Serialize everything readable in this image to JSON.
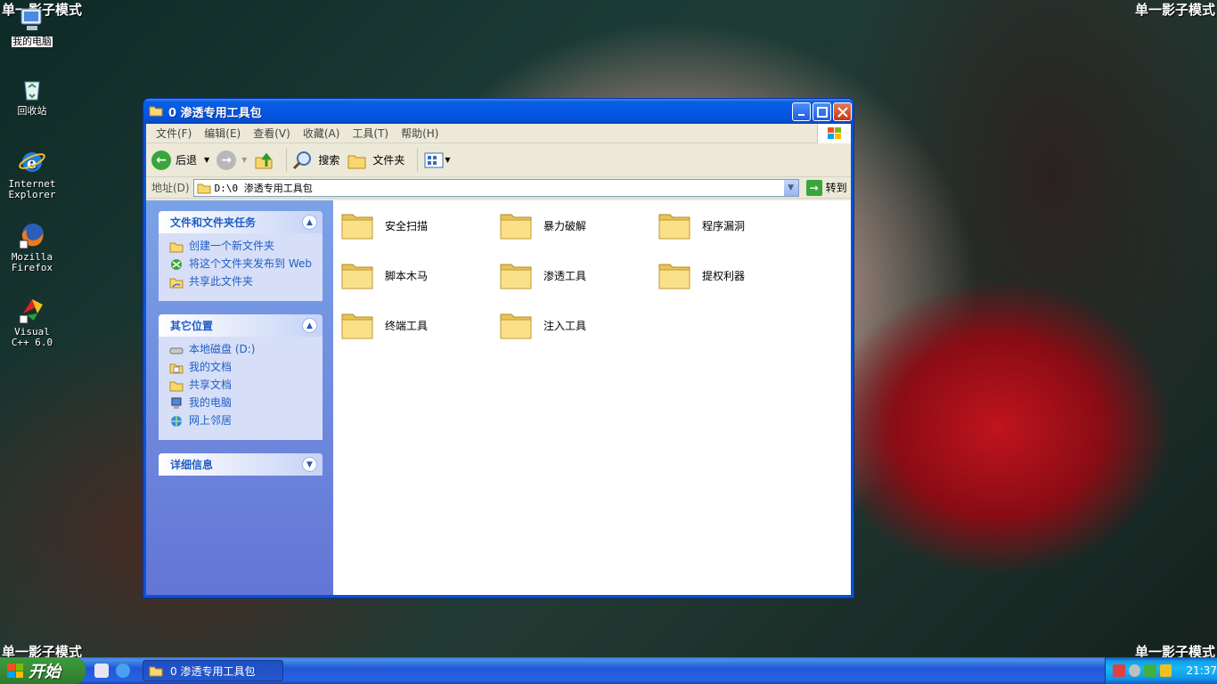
{
  "overlay": {
    "label": "单一影子模式"
  },
  "desktop": {
    "icons": [
      {
        "label": "我的电脑",
        "icon": "my-computer-icon"
      },
      {
        "label": "回收站",
        "icon": "recycle-bin-icon"
      },
      {
        "label": "Internet Explorer",
        "icon": "internet-explorer-icon"
      },
      {
        "label": "Mozilla Firefox",
        "icon": "firefox-icon"
      },
      {
        "label": "Visual C++ 6.0",
        "icon": "visual-cpp-icon"
      }
    ]
  },
  "window": {
    "title": "0 渗透专用工具包",
    "menu": [
      "文件(F)",
      "编辑(E)",
      "查看(V)",
      "收藏(A)",
      "工具(T)",
      "帮助(H)"
    ],
    "toolbar": {
      "back": "后退",
      "search": "搜索",
      "folders": "文件夹"
    },
    "address": {
      "label": "地址(D)",
      "value": "D:\\0 渗透专用工具包",
      "go": "转到"
    },
    "tasks": {
      "file_tasks": {
        "title": "文件和文件夹任务",
        "links": [
          "创建一个新文件夹",
          "将这个文件夹发布到 Web",
          "共享此文件夹"
        ]
      },
      "other_places": {
        "title": "其它位置",
        "links": [
          "本地磁盘 (D:)",
          "我的文档",
          "共享文档",
          "我的电脑",
          "网上邻居"
        ]
      },
      "details": {
        "title": "详细信息"
      }
    },
    "folders": [
      "安全扫描",
      "暴力破解",
      "程序漏洞",
      "脚本木马",
      "渗透工具",
      "提权利器",
      "终端工具",
      "注入工具"
    ]
  },
  "taskbar": {
    "start": "开始",
    "task_title": "0 渗透专用工具包",
    "clock": "21:37"
  },
  "colors": {
    "taskbar": "#2157d7",
    "start": "#388e38",
    "link": "#215dc6",
    "titlebar": "#0558e6"
  }
}
